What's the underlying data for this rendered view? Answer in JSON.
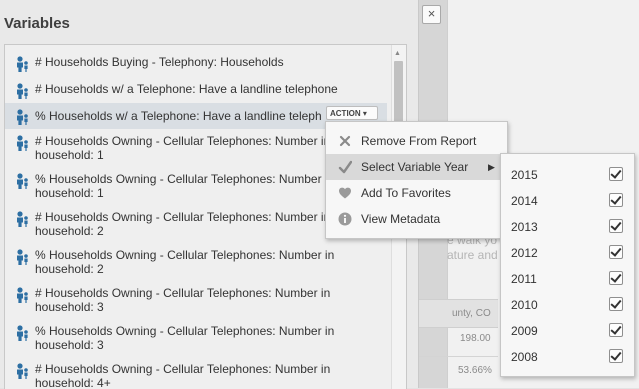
{
  "panel": {
    "title": "Variables",
    "close_label": "×"
  },
  "variables": [
    {
      "line1": "# Households Buying - Telephony: Households",
      "line2": ""
    },
    {
      "line1": "# Households w/ a Telephone: Have a landline telephone",
      "line2": ""
    },
    {
      "line1": "% Households w/ a Telephone: Have a landline teleph",
      "line2": ""
    },
    {
      "line1": "# Households Owning - Cellular Telephones: Number in",
      "line2": "household: 1"
    },
    {
      "line1": "% Households Owning - Cellular Telephones: Number in",
      "line2": "household: 1"
    },
    {
      "line1": "# Households Owning - Cellular Telephones: Number in",
      "line2": "household: 2"
    },
    {
      "line1": "% Households Owning - Cellular Telephones: Number in",
      "line2": "household: 2"
    },
    {
      "line1": "# Households Owning - Cellular Telephones: Number in",
      "line2": "household: 3"
    },
    {
      "line1": "% Households Owning - Cellular Telephones: Number in",
      "line2": "household: 3"
    },
    {
      "line1": "# Households Owning - Cellular Telephones: Number in",
      "line2": "household: 4+"
    }
  ],
  "action_button": {
    "label": "ACTION ▾"
  },
  "action_menu": {
    "items": [
      {
        "label": "Remove From Report",
        "icon": "x-icon"
      },
      {
        "label": "Select Variable Year",
        "icon": "checkmark-icon",
        "has_submenu": true
      },
      {
        "label": "Add To Favorites",
        "icon": "heart-icon"
      },
      {
        "label": "View Metadata",
        "icon": "info-icon"
      }
    ],
    "submenu_arrow": "▶"
  },
  "year_submenu": {
    "years": [
      {
        "label": "2015",
        "checked": true
      },
      {
        "label": "2014",
        "checked": true
      },
      {
        "label": "2013",
        "checked": true
      },
      {
        "label": "2012",
        "checked": true
      },
      {
        "label": "2011",
        "checked": true
      },
      {
        "label": "2010",
        "checked": true
      },
      {
        "label": "2009",
        "checked": true
      },
      {
        "label": "2008",
        "checked": true
      }
    ]
  },
  "background": {
    "text1": "e walk yo",
    "text2": "ature and",
    "header": "unty, CO",
    "cell1": "198.00",
    "cell2": "53.66%"
  },
  "colors": {
    "icon_blue": "#2d6fa3",
    "selected_row": "#d9dee3",
    "menu_highlight": "#d9d9d9"
  }
}
